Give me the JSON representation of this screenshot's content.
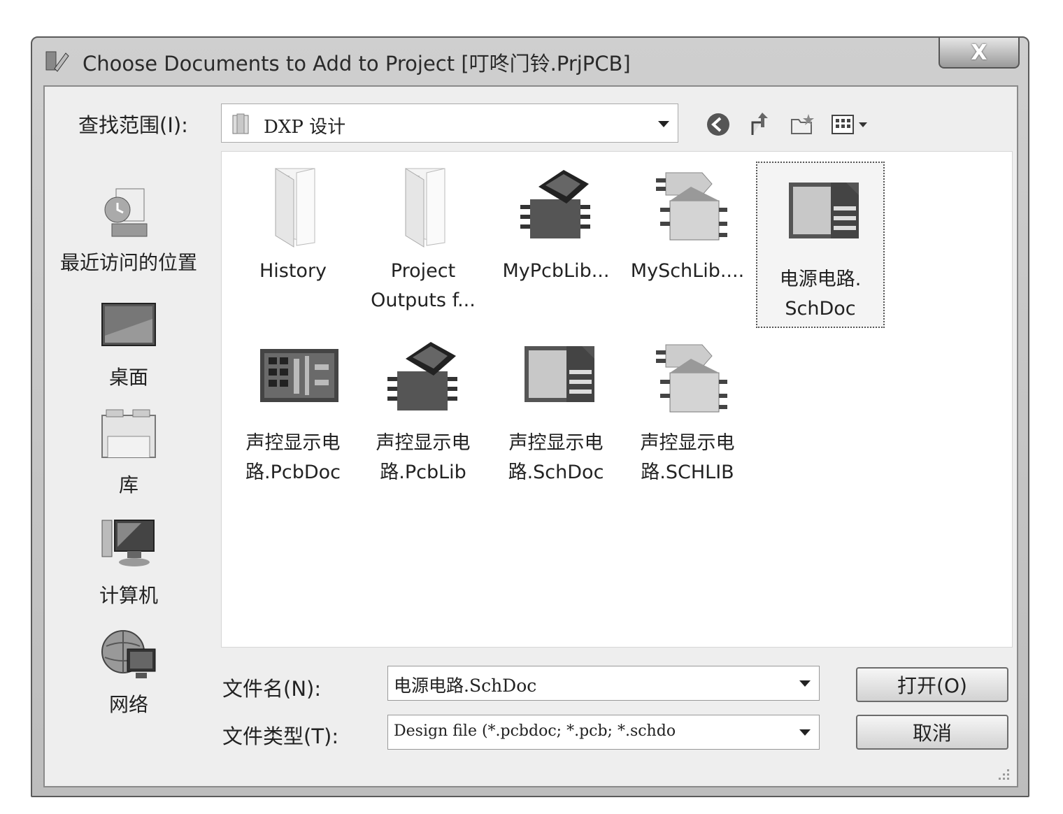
{
  "window": {
    "title": "Choose Documents to Add to Project [叮咚门铃.PrjPCB]",
    "close_label": "X"
  },
  "toolbar": {
    "lookin_label": "查找范围(I):",
    "lookin_value": "DXP 设计"
  },
  "places": [
    {
      "label": "最近访问的位置",
      "icon": "recent-places-icon"
    },
    {
      "label": "桌面",
      "icon": "desktop-icon"
    },
    {
      "label": "库",
      "icon": "libraries-icon"
    },
    {
      "label": "计算机",
      "icon": "computer-icon"
    },
    {
      "label": "网络",
      "icon": "network-icon"
    }
  ],
  "files": [
    {
      "line1": "History",
      "line2": "",
      "icon": "folder-icon"
    },
    {
      "line1": "Project",
      "line2": "Outputs f...",
      "icon": "folder-icon"
    },
    {
      "line1": "MyPcbLib...",
      "line2": "",
      "icon": "pcblib-icon"
    },
    {
      "line1": "MySchLib....",
      "line2": "",
      "icon": "schlib-icon"
    },
    {
      "line1": "电源电路.",
      "line2": "SchDoc",
      "icon": "schdoc-icon"
    },
    {
      "line1": "声控显示电",
      "line2": "路.PcbDoc",
      "icon": "pcbdoc-icon"
    },
    {
      "line1": "声控显示电",
      "line2": "路.PcbLib",
      "icon": "pcblib-icon"
    },
    {
      "line1": "声控显示电",
      "line2": "路.SchDoc",
      "icon": "schdoc-icon"
    },
    {
      "line1": "声控显示电",
      "line2": "路.SCHLIB",
      "icon": "schlib-icon"
    }
  ],
  "form": {
    "filename_label": "文件名(N):",
    "filename_value": "电源电路.SchDoc",
    "filetype_label": "文件类型(T):",
    "filetype_value": "Design file (*.pcbdoc; *.pcb; *.schdo",
    "open_label": "打开(O)",
    "cancel_label": "取消"
  }
}
